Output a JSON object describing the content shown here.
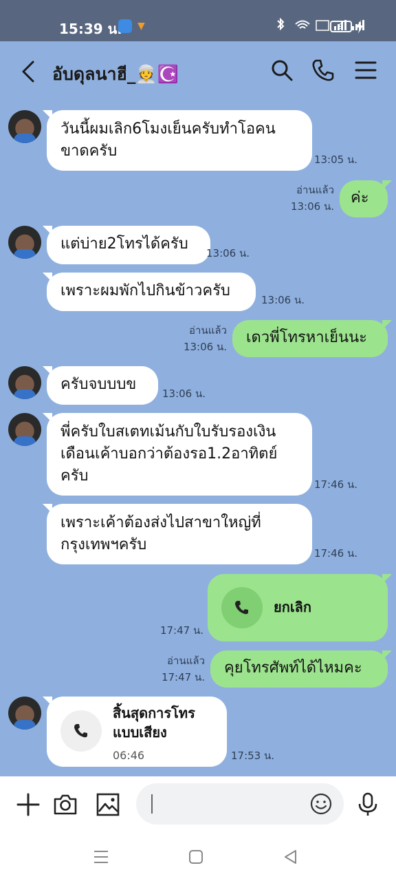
{
  "status_bar": {
    "time": "15:39 น.",
    "system_icons": "bluetooth-icon wifi-icon volte-icon signal-icon signal-icon",
    "battery": "9"
  },
  "header": {
    "title": "อับดุลนาฮี_👳☪️",
    "icons": [
      "back-icon",
      "search-icon",
      "phone-icon",
      "menu-icon"
    ]
  },
  "messages": [
    {
      "from": "them",
      "text": "วันนี้ผมเลิก6โมงเย็นครับทำโอคน\nขาดครับ",
      "time": "13:05 น."
    },
    {
      "from": "me",
      "read": "อ่านแล้ว",
      "text": "ค่ะ",
      "time": "13:06 น."
    },
    {
      "from": "them",
      "text": "แต่บ่าย2โทรได้ครับ",
      "time": "13:06 น."
    },
    {
      "from": "them",
      "text": "เพราะผมพักไปกินข้าวครับ",
      "time": "13:06 น."
    },
    {
      "from": "me",
      "read": "อ่านแล้ว",
      "text": "เดวพี่โทรหาเย็นนะ",
      "time": "13:06 น."
    },
    {
      "from": "them",
      "text": "ครับจบบบข",
      "time": "13:06 น."
    },
    {
      "from": "them",
      "text": "พี่ครับใบสเตทเม้นกับใบรับรองเงิน\nเดือนเค้าบอกว่าต้องรอ1.2อาทิตย์\nครับ",
      "time": "17:46 น."
    },
    {
      "from": "them",
      "text": "เพราะเค้าต้องส่งไปสาขาใหญ่ที่\nกรุงเทพฯครับ",
      "time": "17:46 น."
    },
    {
      "from": "me",
      "type": "call",
      "label": "ยกเลิก",
      "time": "17:47 น."
    },
    {
      "from": "me",
      "read": "อ่านแล้ว",
      "text": "คุยโทรศัพท์ได้ไหมคะ",
      "time": "17:47 น."
    },
    {
      "from": "them",
      "type": "call",
      "label": "สิ้นสุดการโทร\nแบบเสียง",
      "duration": "06:46",
      "time": "17:53 น."
    }
  ],
  "input_bar": {
    "icons": [
      "plus-icon",
      "camera-icon",
      "image-icon",
      "emoji-icon",
      "mic-icon"
    ],
    "placeholder": ""
  },
  "nav_bar": {
    "icons": [
      "recents-icon",
      "home-icon",
      "back-nav-icon"
    ]
  },
  "colors": {
    "background": "#8fb0de",
    "status_bar": "#58677f",
    "incoming_bubble": "#ffffff",
    "outgoing_bubble": "#9ce38e"
  }
}
